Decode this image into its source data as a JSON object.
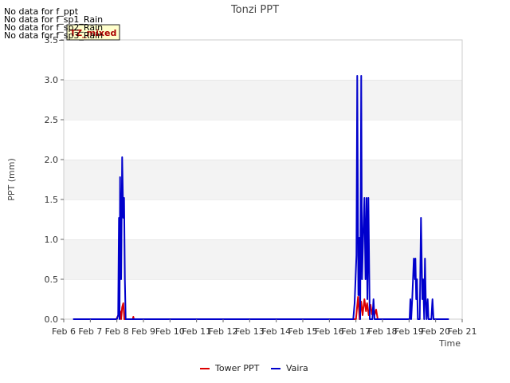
{
  "chart_data": {
    "type": "line",
    "title": "Tonzi PPT",
    "xlabel": "Time",
    "ylabel": "PPT (mm)",
    "xlim": [
      6,
      21
    ],
    "ylim": [
      0,
      3.5
    ],
    "x_ticks": [
      6,
      7,
      8,
      9,
      10,
      11,
      12,
      13,
      14,
      15,
      16,
      17,
      18,
      19,
      20,
      21
    ],
    "x_tick_labels": [
      "Feb 6",
      "Feb 7",
      "Feb 8",
      "Feb 9",
      "Feb 10",
      "Feb 11",
      "Feb 12",
      "Feb 13",
      "Feb 14",
      "Feb 15",
      "Feb 16",
      "Feb 17",
      "Feb 18",
      "Feb 19",
      "Feb 20",
      "Feb 21"
    ],
    "y_ticks": [
      0,
      0.5,
      1.0,
      1.5,
      2.0,
      2.5,
      3.0,
      3.5
    ],
    "y_tick_labels": [
      "0.0",
      "0.5",
      "1.0",
      "1.5",
      "2.0",
      "2.5",
      "3.0",
      "3.5"
    ],
    "grid": "horizontal bands",
    "legend_position": "bottom-center",
    "no_data_messages": [
      "No data for f_ppt",
      "No data for f_sp1_Rain",
      "No data for f_sp2_Rain",
      "No data for f_sp3_Rain"
    ],
    "badge": "TZ_mixed",
    "series": [
      {
        "name": "Tower PPT",
        "color": "#dd0000",
        "x": [
          7.98,
          8.12,
          8.16,
          8.2,
          8.24,
          8.28,
          8.6,
          8.62,
          8.64,
          17.0,
          17.08,
          17.14,
          17.2,
          17.25,
          17.32,
          17.38,
          17.42,
          17.48,
          17.55,
          17.6,
          17.65,
          17.7,
          17.76,
          17.82
        ],
        "y": [
          0,
          0.1,
          0,
          0.15,
          0.2,
          0,
          0,
          0.03,
          0,
          0,
          0.28,
          0,
          0.22,
          0.05,
          0.25,
          0.1,
          0.2,
          0.05,
          0.18,
          0.06,
          0.15,
          0.05,
          0.12,
          0
        ]
      },
      {
        "name": "Vaira",
        "color": "#0000cc",
        "x": [
          6.35,
          7.95,
          8.0,
          8.05,
          8.08,
          8.1,
          8.12,
          8.16,
          8.2,
          8.24,
          8.27,
          8.3,
          8.33,
          8.36,
          16.9,
          16.95,
          17.02,
          17.05,
          17.09,
          17.13,
          17.16,
          17.2,
          17.23,
          17.27,
          17.32,
          17.36,
          17.4,
          17.43,
          17.47,
          17.52,
          17.57,
          17.62,
          17.66,
          17.7,
          17.73,
          17.78,
          17.82,
          17.86,
          17.9,
          17.93,
          17.97,
          18.0,
          18.03,
          18.06,
          18.1,
          18.5,
          19.02,
          19.05,
          19.08,
          19.12,
          19.15,
          19.18,
          19.22,
          19.24,
          19.27,
          19.3,
          19.33,
          19.36,
          19.4,
          19.45,
          19.5,
          19.53,
          19.57,
          19.6,
          19.63,
          19.66,
          19.7,
          19.73,
          19.76,
          19.8,
          19.84,
          19.88,
          19.92,
          19.96,
          20.0,
          20.04,
          20.08,
          20.12,
          20.5
        ],
        "y": [
          0,
          0,
          0,
          0.05,
          1.27,
          0,
          1.78,
          0.5,
          2.03,
          1.27,
          1.52,
          0.5,
          0,
          0,
          0,
          0.2,
          0.8,
          3.05,
          0.3,
          1.02,
          0,
          3.05,
          0.5,
          1.02,
          1.52,
          0.5,
          1.52,
          0.25,
          1.52,
          0,
          0,
          0,
          0.25,
          0,
          0,
          0,
          0,
          0,
          0,
          0,
          0,
          0,
          0,
          0,
          0,
          0,
          0,
          0.25,
          0,
          0.25,
          0.5,
          0.76,
          0.5,
          0.76,
          0.25,
          0.5,
          0,
          0,
          0,
          1.27,
          0.25,
          0.5,
          0,
          0.76,
          0.25,
          0,
          0.25,
          0,
          0,
          0,
          0,
          0.25,
          0,
          0,
          0,
          0,
          0,
          0,
          0
        ]
      }
    ]
  }
}
